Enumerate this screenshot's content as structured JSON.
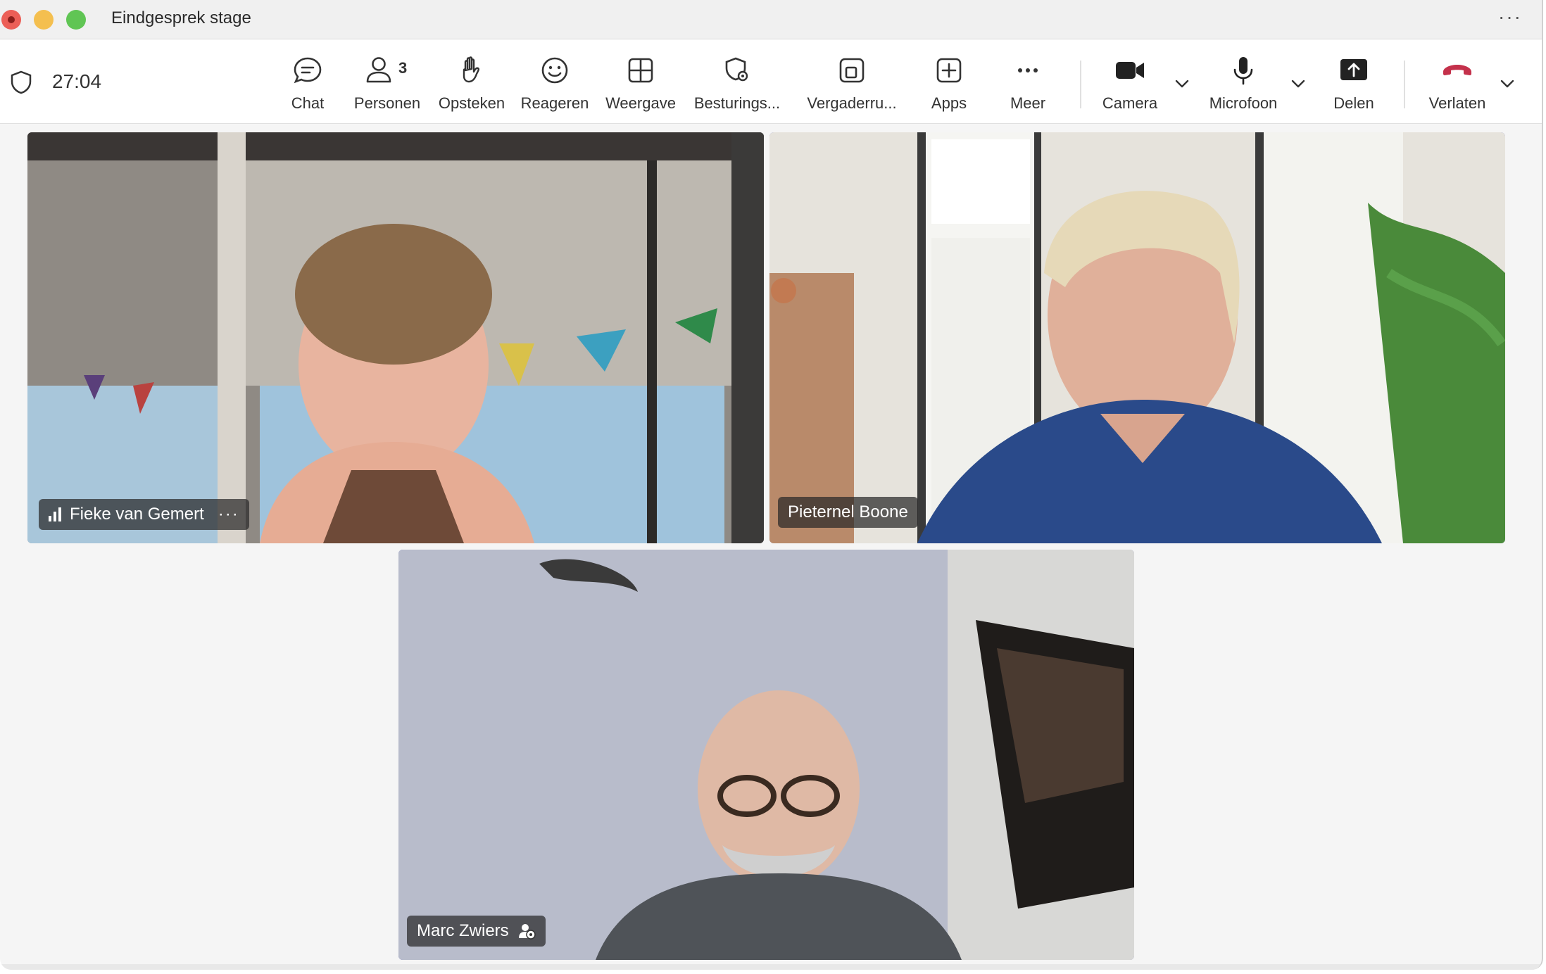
{
  "window": {
    "title": "Eindgesprek stage",
    "more": "···"
  },
  "toolbar": {
    "timer": "27:04",
    "chat": "Chat",
    "people": "Personen",
    "people_count": "3",
    "raise": "Opsteken",
    "react": "Reageren",
    "view": "Weergave",
    "controls": "Besturings...",
    "rooms": "Vergaderru...",
    "apps": "Apps",
    "more": "Meer",
    "camera": "Camera",
    "mic": "Microfoon",
    "share": "Delen",
    "leave": "Verlaten"
  },
  "participants": [
    {
      "name": "Fieke van Gemert",
      "more": "···"
    },
    {
      "name": "Pieternel Boone"
    },
    {
      "name": "Marc Zwiers"
    }
  ],
  "colors": {
    "accent": "#5b5fc7",
    "leave": "#c4314b"
  }
}
